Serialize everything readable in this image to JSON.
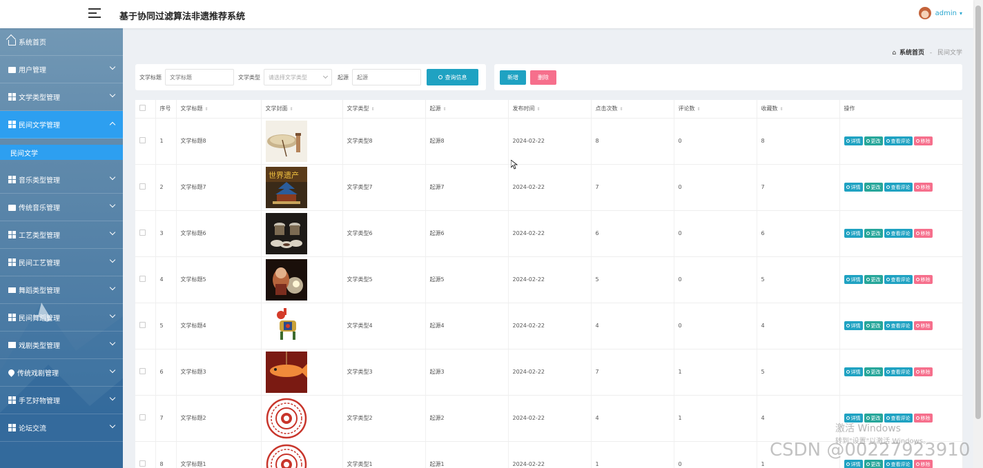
{
  "header": {
    "app_title": "基于协同过滤算法非遗推荐系统",
    "user_name": "admin",
    "user_caret": "▾"
  },
  "sidebar": {
    "items": [
      {
        "label": "系统首页",
        "icon": "home-icon"
      },
      {
        "label": "用户管理",
        "icon": "briefcase-icon"
      },
      {
        "label": "文学类型管理",
        "icon": "grid-icon"
      },
      {
        "label": "民间文学管理",
        "icon": "grid-icon",
        "open": true
      },
      {
        "label": "音乐类型管理",
        "icon": "grid-icon"
      },
      {
        "label": "传统音乐管理",
        "icon": "clipboard-icon"
      },
      {
        "label": "工艺类型管理",
        "icon": "grid-icon"
      },
      {
        "label": "民间工艺管理",
        "icon": "grid-icon"
      },
      {
        "label": "舞蹈类型管理",
        "icon": "monitor-icon"
      },
      {
        "label": "民间舞蹈管理",
        "icon": "grid-icon"
      },
      {
        "label": "戏剧类型管理",
        "icon": "film-icon"
      },
      {
        "label": "传统戏剧管理",
        "icon": "pin-icon"
      },
      {
        "label": "手艺好物管理",
        "icon": "grid-icon"
      },
      {
        "label": "论坛交流",
        "icon": "grid-icon"
      }
    ],
    "active_sub": "民间文学"
  },
  "breadcrumb": {
    "home": "系统首页",
    "separator": "-",
    "current": "民间文学"
  },
  "search": {
    "title_label": "文学标题",
    "title_placeholder": "文学标题",
    "type_label": "文学类型",
    "type_placeholder": "请选择文学类型",
    "origin_label": "起源",
    "origin_placeholder": "起源",
    "button": "查询信息"
  },
  "actions": {
    "add": "新增",
    "delete": "删除"
  },
  "table": {
    "headers": {
      "index": "序号",
      "title": "文学标题",
      "cover": "文学封面",
      "type": "文学类型",
      "origin": "起源",
      "date": "发布时间",
      "clicks": "点击次数",
      "comments": "评论数",
      "favorites": "收藏数",
      "ops": "操作"
    },
    "sort_glyph": "⇕",
    "op_labels": {
      "detail": "详情",
      "edit": "更改",
      "comment": "查看评论",
      "remove": "移除"
    },
    "rows": [
      {
        "index": "1",
        "title": "文学标题8",
        "type": "文学类型8",
        "origin": "起源8",
        "date": "2024-02-22",
        "clicks": "8",
        "comments": "0",
        "favorites": "8",
        "cover": "umbrella"
      },
      {
        "index": "2",
        "title": "文学标题7",
        "type": "文学类型7",
        "origin": "起源7",
        "date": "2024-02-22",
        "clicks": "7",
        "comments": "0",
        "favorites": "7",
        "cover": "temple"
      },
      {
        "index": "3",
        "title": "文学标题6",
        "type": "文学类型6",
        "origin": "起源6",
        "date": "2024-02-22",
        "clicks": "6",
        "comments": "0",
        "favorites": "6",
        "cover": "bowls"
      },
      {
        "index": "4",
        "title": "文学标题5",
        "type": "文学类型5",
        "origin": "起源5",
        "date": "2024-02-22",
        "clicks": "5",
        "comments": "0",
        "favorites": "5",
        "cover": "candle"
      },
      {
        "index": "5",
        "title": "文学标题4",
        "type": "文学类型4",
        "origin": "起源4",
        "date": "2024-02-22",
        "clicks": "4",
        "comments": "0",
        "favorites": "4",
        "cover": "papercut-horse"
      },
      {
        "index": "6",
        "title": "文学标题3",
        "type": "文学类型3",
        "origin": "起源3",
        "date": "2024-02-22",
        "clicks": "7",
        "comments": "1",
        "favorites": "5",
        "cover": "fish-lantern"
      },
      {
        "index": "7",
        "title": "文学标题2",
        "type": "文学类型2",
        "origin": "起源2",
        "date": "2024-02-22",
        "clicks": "4",
        "comments": "1",
        "favorites": "4",
        "cover": "papercut-circle"
      },
      {
        "index": "8",
        "title": "文学标题1",
        "type": "文学类型1",
        "origin": "起源1",
        "date": "2024-02-22",
        "clicks": "1",
        "comments": "0",
        "favorites": "1",
        "cover": "papercut-circle"
      }
    ]
  },
  "watermarks": {
    "windows_title": "激活 Windows",
    "windows_sub": "转到\"设置\"以激活 Windows。",
    "csdn": "CSDN @00227923910"
  },
  "colors": {
    "primary": "#1fa2c2",
    "danger": "#f66f8c",
    "success": "#26a69a",
    "sidebar_active": "#2d9ff0"
  }
}
